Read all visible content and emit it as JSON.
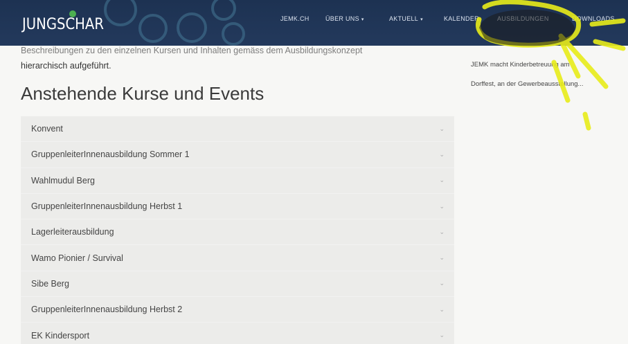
{
  "header": {
    "logo_text": "JUNGSCHAR",
    "nav": [
      {
        "label": "JEMK.CH",
        "dropdown": false
      },
      {
        "label": "ÜBER UNS",
        "dropdown": true
      },
      {
        "label": "AKTUELL",
        "dropdown": true
      },
      {
        "label": "KALENDER",
        "dropdown": false
      },
      {
        "label": "AUSBILDUNGEN",
        "dropdown": false,
        "active": true
      },
      {
        "label": "DOWNLOADS",
        "dropdown": false
      }
    ],
    "caret": "▾"
  },
  "intro": {
    "line1": "Beschreibungen zu den einzelnen Kursen und Inhalten gemäss dem Ausbildungskonzept",
    "line2": "hierarchisch aufgeführt."
  },
  "sidebar": {
    "lines": [
      "JEMK macht Kinderbetreuung am",
      "Dorffest, an der Gewerbeausstellung..."
    ]
  },
  "main": {
    "heading": "Anstehende Kurse und Events",
    "chevron": "⌄",
    "courses": [
      "Konvent",
      "GruppenleiterInnenausbildung Sommer 1",
      "Wahlmudul Berg",
      "GruppenleiterInnenausbildung Herbst 1",
      "Lagerleiterausbildung",
      "Wamo Pionier / Survival",
      "Sibe Berg",
      "GruppenleiterInnenausbildung Herbst 2",
      "EK Kindersport"
    ]
  },
  "colors": {
    "header_bg": "#1f3556",
    "highlight_yellow": "#e8ec1a",
    "accordion_bg": "#ececea"
  }
}
